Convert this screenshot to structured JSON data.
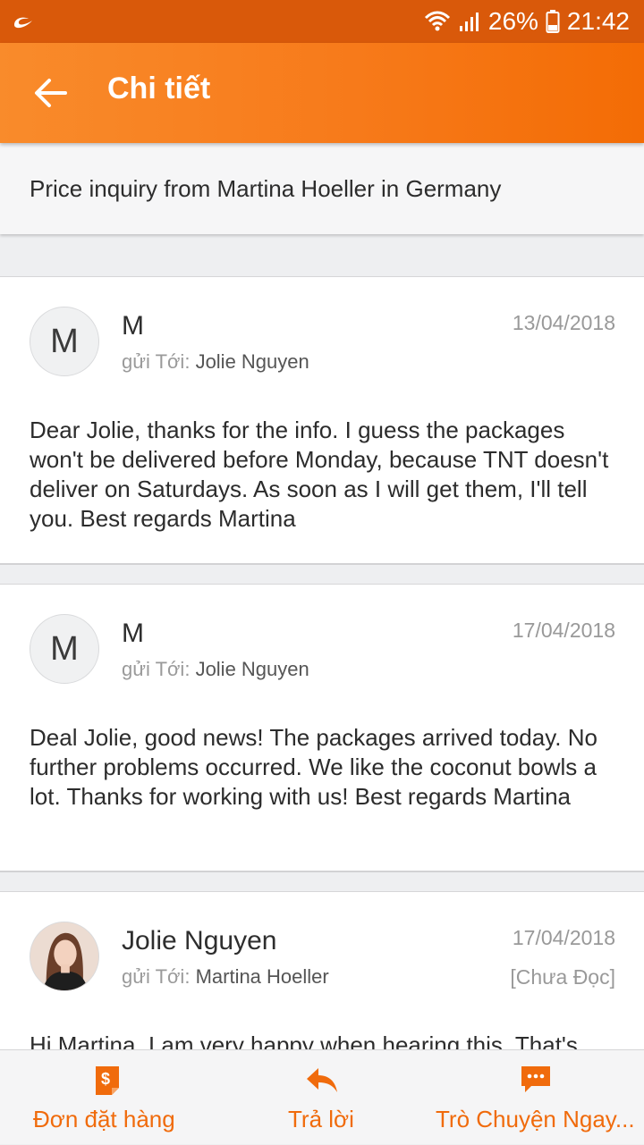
{
  "status_bar": {
    "battery": "26%",
    "time": "21:42"
  },
  "app_bar": {
    "title": "Chi tiết"
  },
  "subject": "Price inquiry from Martina Hoeller in Germany",
  "messages": [
    {
      "avatar_letter": "M",
      "sender": "M",
      "to_prefix": "gửi Tới:",
      "recipient": "Jolie Nguyen",
      "date": "13/04/2018",
      "body": "Dear Jolie, thanks for the info. I guess the packages won't be delivered before Monday, because TNT doesn't deliver on Saturdays.  As soon as I will get them, I'll tell you. Best regards Martina"
    },
    {
      "avatar_letter": "M",
      "sender": "M",
      "to_prefix": "gửi Tới:",
      "recipient": "Jolie Nguyen",
      "date": "17/04/2018",
      "body": "Deal Jolie, good news! The packages arrived today. No further problems occurred. We like the coconut bowls a lot. Thanks for working with us! Best regards Martina"
    },
    {
      "sender": "Jolie Nguyen",
      "to_prefix": "gửi Tới:",
      "recipient": "Martina Hoeller",
      "date": "17/04/2018",
      "status": "[Chưa Đọc]",
      "body": "Hi Martina, I am very happy when hearing this. That's"
    }
  ],
  "bottom_bar": {
    "orders_label": "Đơn đặt hàng",
    "reply_label": "Trả lời",
    "chat_label": "Trò Chuyện Ngay..."
  },
  "colors": {
    "accent": "#f06b0c",
    "status_bar": "#d9590a"
  },
  "icons": {
    "back": "arrow-left-icon",
    "orders": "order-dollar-icon",
    "reply": "reply-icon",
    "chat": "chat-bubble-icon"
  }
}
